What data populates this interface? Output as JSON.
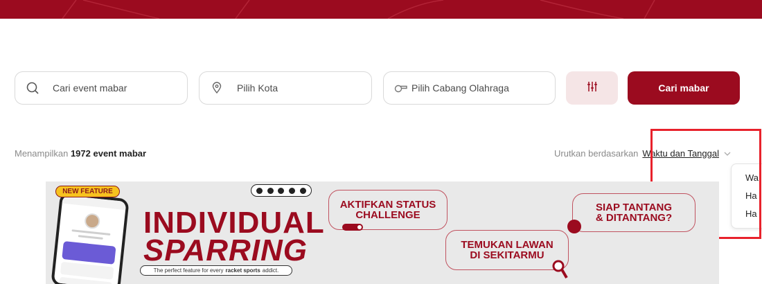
{
  "search": {
    "event_placeholder": "Cari event mabar",
    "city_placeholder": "Pilih Kota",
    "sport_placeholder": "Pilih Cabang Olahraga",
    "search_button_label": "Cari mabar",
    "icons": {
      "event": "search-icon",
      "city": "location-pin-icon",
      "sport": "sport-whistle-icon",
      "filter": "filter-sliders-icon"
    }
  },
  "results": {
    "prefix": "Menampilkan",
    "count_text": "1972 event mabar"
  },
  "sort": {
    "label": "Urutkan berdasarkan",
    "selected": "Waktu dan Tanggal",
    "options": [
      "Wa",
      "Ha",
      "Ha"
    ]
  },
  "promo": {
    "badge": "NEW FEATURE",
    "title_line1": "INDIVIDUAL",
    "title_line2": "SPARRING",
    "tagline_pre": "The perfect feature for every",
    "tagline_bold": "racket sports",
    "tagline_post": "addict.",
    "callout1_line1": "AKTIFKAN STATUS",
    "callout1_line2": "CHALLENGE",
    "callout2_line1": "TEMUKAN LAWAN",
    "callout2_line2": "DI SEKITARMU",
    "callout3_line1": "SIAP TANTANG",
    "callout3_line2": "& DITANTANG?"
  },
  "colors": {
    "brand": "#9b0b1f",
    "filter_bg": "#f5e5e6",
    "badge_yellow": "#f7c21f",
    "highlight_red": "#e8212b"
  }
}
